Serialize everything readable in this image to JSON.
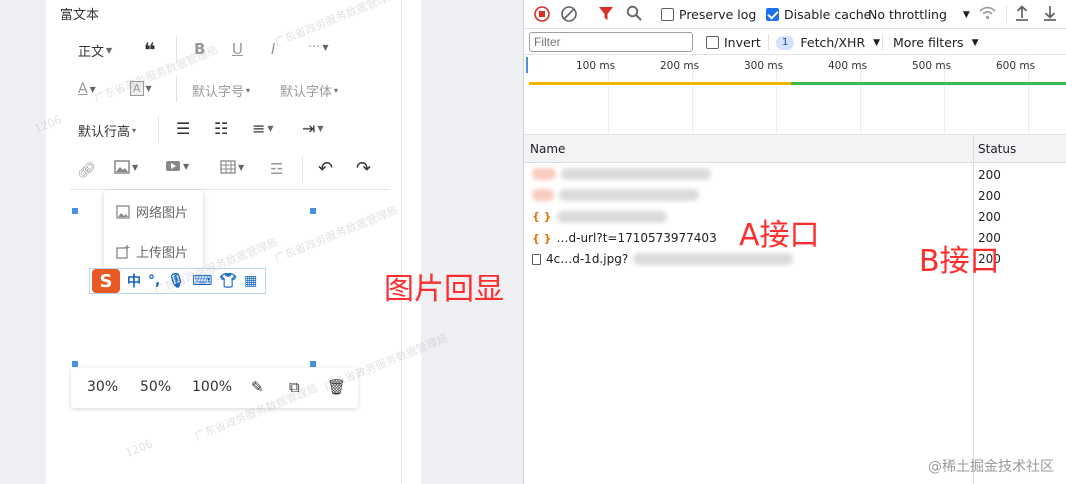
{
  "editor": {
    "section_title": "富文本",
    "toolbar": {
      "paragraph": "正文",
      "font_size": "默认字号",
      "font_family": "默认字体",
      "line_height": "默认行高"
    },
    "image_menu": {
      "network_image": "网络图片",
      "upload_image": "上传图片"
    },
    "ime": {
      "logo": "S",
      "chinese": "中",
      "punct": "°,"
    },
    "size_options": [
      "30%",
      "50%",
      "100%"
    ],
    "watermark_text": "广东省政务服务数据管理局",
    "watermark_short": "1206"
  },
  "annotations": {
    "image_echo": "图片回显",
    "api_a": "A接口",
    "api_b": "B接口"
  },
  "devtools": {
    "preserve_log": "Preserve log",
    "disable_cache": "Disable cache",
    "throttling": "No throttling",
    "filter_placeholder": "Filter",
    "invert": "Invert",
    "fetch_badge": "1",
    "fetch_xhr": "Fetch/XHR",
    "more_filters": "More filters",
    "timeline_ticks": [
      "100 ms",
      "200 ms",
      "300 ms",
      "400 ms",
      "500 ms",
      "600 ms"
    ],
    "columns": {
      "name": "Name",
      "status": "Status"
    },
    "requests": [
      {
        "name": "",
        "status": "200"
      },
      {
        "name": "",
        "status": "200"
      },
      {
        "name": "",
        "status": "200"
      },
      {
        "name": "…d-url?t=1710573977403",
        "status": "200"
      },
      {
        "name": "4c…d-1d.jpg?",
        "status": "200"
      }
    ],
    "colors": {
      "accent": "#1a73e8",
      "waterfall_wait": "#f4b400",
      "waterfall_receive": "#3cba54"
    }
  },
  "footer_mark": "@稀土掘金技术社区"
}
